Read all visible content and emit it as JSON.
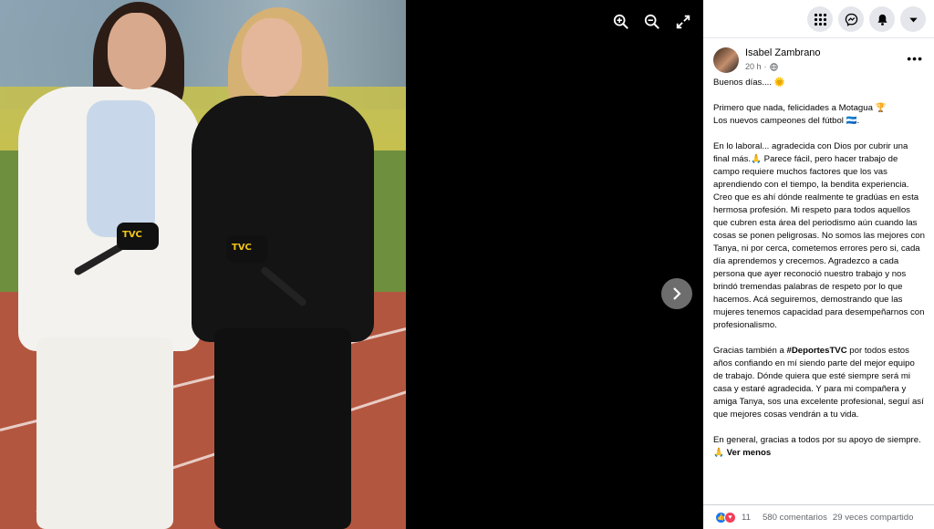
{
  "viewer": {
    "icons": [
      "zoom-in-icon",
      "zoom-out-icon",
      "fullscreen-icon",
      "chevron-right-icon"
    ],
    "mic_logo": "TVC"
  },
  "topbar": {
    "icons": [
      "menu-grid-icon",
      "messenger-icon",
      "notifications-icon",
      "account-caret-icon"
    ]
  },
  "post": {
    "author": "Isabel Zambrano",
    "time": "20 h",
    "more": "•••",
    "paragraphs": [
      "Buenos días.... 🌞",
      "Primero que nada, felicidades a Motagua 🏆\nLos nuevos campeones del fútbol 🇭🇳.",
      "En lo laboral... agradecida con Dios por cubrir una final más.🙏 Parece fácil, pero hacer trabajo de campo requiere muchos factores que los vas aprendiendo con el tiempo, la bendita experiencia. Creo que es ahí dónde realmente te gradúas en esta hermosa profesión. Mi respeto para todos aquellos que cubren esta área del periodismo aún cuando las cosas se ponen peligrosas. No somos las mejores con Tanya, ni por cerca, cometemos errores pero si, cada día aprendemos y crecemos. Agradezco a cada persona que ayer reconoció nuestro trabajo y nos brindó tremendas palabras de respeto por lo que hacemos. Acá seguiremos, demostrando que las mujeres tenemos capacidad para desempeñarnos con profesionalismo."
    ],
    "p4_before": "Gracias también a ",
    "hashtag": "#DeportesTVC",
    "p4_after": " por todos estos años confiando en mí siendo parte del mejor equipo de trabajo. Dónde quiera que esté siempre será mi casa y estaré agradecida. Y para mi compañera y amiga Tanya, sos una excelente profesional, seguí así que mejores cosas vendrán a tu vida.",
    "p5": "En general, gracias a todos por su apoyo de siempre. 🙏 ",
    "see_less": "Ver menos"
  },
  "footer": {
    "reaction_count": "11",
    "comments": "580 comentarios",
    "shares": "29 veces compartido"
  },
  "colors": {
    "like": "#1877f2",
    "love": "#f33e58",
    "button_bg": "#e4e6eb"
  }
}
